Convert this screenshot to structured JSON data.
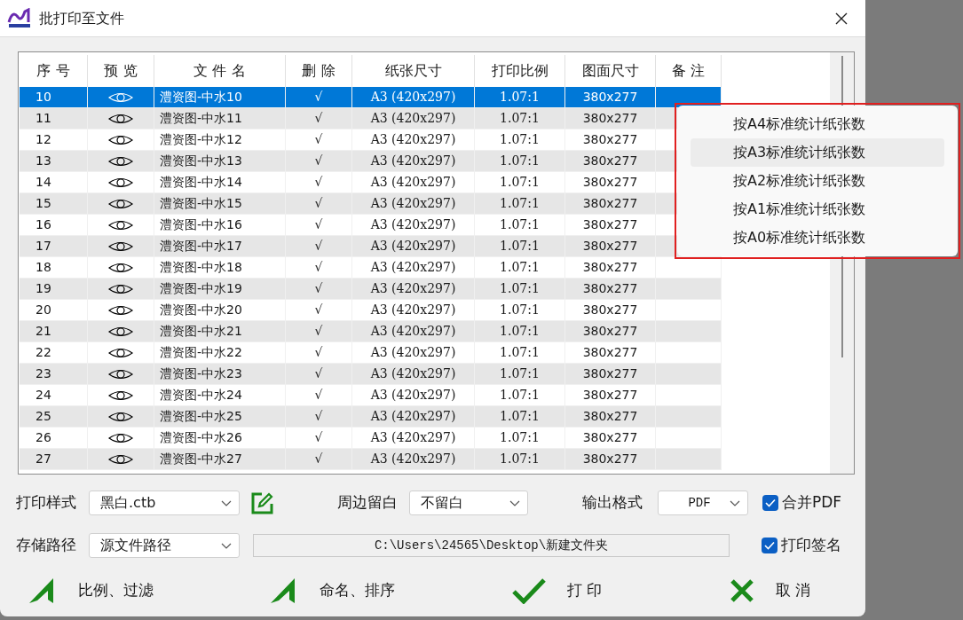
{
  "window": {
    "title": "批打印至文件"
  },
  "table": {
    "columns": [
      "序 号",
      "预 览",
      "文 件 名",
      "删 除",
      "纸张尺寸",
      "打印比例",
      "图面尺寸",
      "备 注"
    ],
    "rows": [
      {
        "no": "10",
        "name": "澧资图-中水10",
        "delete": "√",
        "paper": "A3 (420x297)",
        "scale": "1.07:1",
        "size": "380x277",
        "selected": true
      },
      {
        "no": "11",
        "name": "澧资图-中水11",
        "delete": "√",
        "paper": "A3 (420x297)",
        "scale": "1.07:1",
        "size": "380x277",
        "selected": false
      },
      {
        "no": "12",
        "name": "澧资图-中水12",
        "delete": "√",
        "paper": "A3 (420x297)",
        "scale": "1.07:1",
        "size": "380x277",
        "selected": false
      },
      {
        "no": "13",
        "name": "澧资图-中水13",
        "delete": "√",
        "paper": "A3 (420x297)",
        "scale": "1.07:1",
        "size": "380x277",
        "selected": false
      },
      {
        "no": "14",
        "name": "澧资图-中水14",
        "delete": "√",
        "paper": "A3 (420x297)",
        "scale": "1.07:1",
        "size": "380x277",
        "selected": false
      },
      {
        "no": "15",
        "name": "澧资图-中水15",
        "delete": "√",
        "paper": "A3 (420x297)",
        "scale": "1.07:1",
        "size": "380x277",
        "selected": false
      },
      {
        "no": "16",
        "name": "澧资图-中水16",
        "delete": "√",
        "paper": "A3 (420x297)",
        "scale": "1.07:1",
        "size": "380x277",
        "selected": false
      },
      {
        "no": "17",
        "name": "澧资图-中水17",
        "delete": "√",
        "paper": "A3 (420x297)",
        "scale": "1.07:1",
        "size": "380x277",
        "selected": false
      },
      {
        "no": "18",
        "name": "澧资图-中水18",
        "delete": "√",
        "paper": "A3 (420x297)",
        "scale": "1.07:1",
        "size": "380x277",
        "selected": false
      },
      {
        "no": "19",
        "name": "澧资图-中水19",
        "delete": "√",
        "paper": "A3 (420x297)",
        "scale": "1.07:1",
        "size": "380x277",
        "selected": false
      },
      {
        "no": "20",
        "name": "澧资图-中水20",
        "delete": "√",
        "paper": "A3 (420x297)",
        "scale": "1.07:1",
        "size": "380x277",
        "selected": false
      },
      {
        "no": "21",
        "name": "澧资图-中水21",
        "delete": "√",
        "paper": "A3 (420x297)",
        "scale": "1.07:1",
        "size": "380x277",
        "selected": false
      },
      {
        "no": "22",
        "name": "澧资图-中水22",
        "delete": "√",
        "paper": "A3 (420x297)",
        "scale": "1.07:1",
        "size": "380x277",
        "selected": false
      },
      {
        "no": "23",
        "name": "澧资图-中水23",
        "delete": "√",
        "paper": "A3 (420x297)",
        "scale": "1.07:1",
        "size": "380x277",
        "selected": false
      },
      {
        "no": "24",
        "name": "澧资图-中水24",
        "delete": "√",
        "paper": "A3 (420x297)",
        "scale": "1.07:1",
        "size": "380x277",
        "selected": false
      },
      {
        "no": "25",
        "name": "澧资图-中水25",
        "delete": "√",
        "paper": "A3 (420x297)",
        "scale": "1.07:1",
        "size": "380x277",
        "selected": false
      },
      {
        "no": "26",
        "name": "澧资图-中水26",
        "delete": "√",
        "paper": "A3 (420x297)",
        "scale": "1.07:1",
        "size": "380x277",
        "selected": false
      },
      {
        "no": "27",
        "name": "澧资图-中水27",
        "delete": "√",
        "paper": "A3 (420x297)",
        "scale": "1.07:1",
        "size": "380x277",
        "selected": false
      }
    ]
  },
  "context_menu": {
    "items": [
      {
        "label": "按A4标准统计纸张数",
        "selected": false
      },
      {
        "label": "按A3标准统计纸张数",
        "selected": true
      },
      {
        "label": "按A2标准统计纸张数",
        "selected": false
      },
      {
        "label": "按A1标准统计纸张数",
        "selected": false
      },
      {
        "label": "按A0标准统计纸张数",
        "selected": false
      }
    ]
  },
  "settings": {
    "print_style": {
      "label": "打印样式",
      "value": "黑白.ctb"
    },
    "margin": {
      "label": "周边留白",
      "value": "不留白"
    },
    "output_format": {
      "label": "输出格式",
      "value": "PDF"
    },
    "merge_pdf": {
      "label": "合并PDF",
      "checked": true
    },
    "save_path": {
      "label": "存储路径",
      "value": "源文件路径"
    },
    "path": {
      "value": "C:\\Users\\24565\\Desktop\\新建文件夹"
    },
    "print_signature": {
      "label": "打印签名",
      "checked": true
    }
  },
  "buttons": [
    {
      "label": "比例、过滤",
      "kind": "a"
    },
    {
      "label": "命名、排序",
      "kind": "a"
    },
    {
      "label": "打 印",
      "kind": "check"
    },
    {
      "label": "取 消",
      "kind": "cross"
    }
  ]
}
